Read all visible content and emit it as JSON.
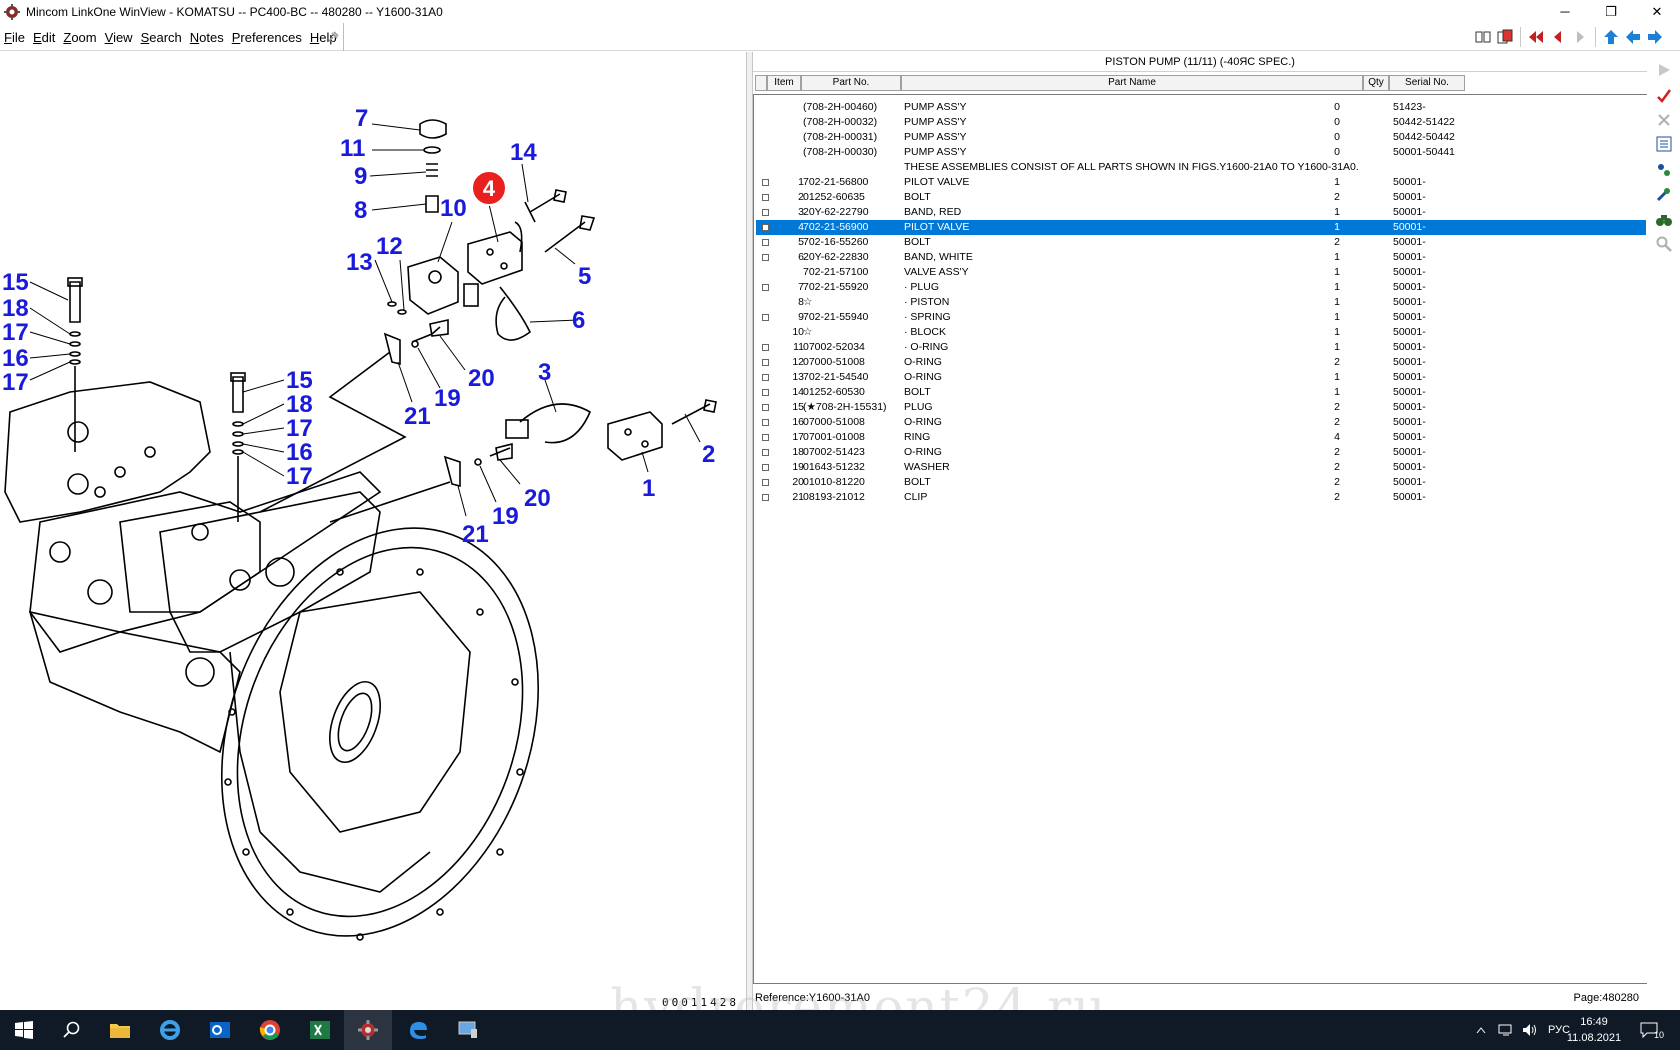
{
  "window": {
    "title": "Mincom LinkOne WinView - KOMATSU -- PC400-BC -- 480280 -- Y1600-31A0",
    "minimize": "─",
    "restore": "❐",
    "close": "✕"
  },
  "menu": {
    "items": [
      {
        "label": "File"
      },
      {
        "label": "Edit"
      },
      {
        "label": "Zoom"
      },
      {
        "label": "View"
      },
      {
        "label": "Search"
      },
      {
        "label": "Notes"
      },
      {
        "label": "Preferences"
      },
      {
        "label": "Help"
      }
    ]
  },
  "drawing": {
    "number": "00011428",
    "callouts": [
      "7",
      "11",
      "9",
      "8",
      "10",
      "14",
      "4",
      "13",
      "12",
      "5",
      "6",
      "15",
      "18",
      "17",
      "16",
      "17",
      "15",
      "18",
      "17",
      "16",
      "17",
      "20",
      "19",
      "21",
      "3",
      "2",
      "1",
      "20",
      "19",
      "21"
    ]
  },
  "parts_list": {
    "title": "PISTON PUMP (11/11) (-40ЯС SPEC.)",
    "columns": {
      "item": "Item",
      "part_no": "Part No.",
      "part_name": "Part Name",
      "qty": "Qty",
      "serial": "Serial No."
    },
    "rows": [
      {
        "cb": false,
        "item": "",
        "part_no": "(708-2H-00460)",
        "name": "PUMP ASS'Y",
        "qty": "0",
        "serial": "51423-"
      },
      {
        "cb": false,
        "item": "",
        "part_no": "(708-2H-00032)",
        "name": "PUMP ASS'Y",
        "qty": "0",
        "serial": "50442-51422"
      },
      {
        "cb": false,
        "item": "",
        "part_no": "(708-2H-00031)",
        "name": "PUMP ASS'Y",
        "qty": "0",
        "serial": "50442-50442"
      },
      {
        "cb": false,
        "item": "",
        "part_no": "(708-2H-00030)",
        "name": "PUMP ASS'Y",
        "qty": "0",
        "serial": "50001-50441"
      },
      {
        "cb": false,
        "item": "",
        "part_no": "",
        "name": "THESE ASSEMBLIES CONSIST OF ALL PARTS SHOWN IN FIGS.Y1600-21A0 TO Y1600-31A0.",
        "qty": "",
        "serial": ""
      },
      {
        "cb": true,
        "item": "1",
        "part_no": "702-21-56800",
        "name": "PILOT VALVE",
        "qty": "1",
        "serial": "50001-"
      },
      {
        "cb": true,
        "item": "2",
        "part_no": "01252-60635",
        "name": "BOLT",
        "qty": "2",
        "serial": "50001-"
      },
      {
        "cb": true,
        "item": "3",
        "part_no": "20Y-62-22790",
        "name": "BAND, RED",
        "qty": "1",
        "serial": "50001-"
      },
      {
        "cb": true,
        "item": "4",
        "part_no": "702-21-56900",
        "name": "PILOT VALVE",
        "qty": "1",
        "serial": "50001-",
        "selected": true
      },
      {
        "cb": true,
        "item": "5",
        "part_no": "702-16-55260",
        "name": "BOLT",
        "qty": "2",
        "serial": "50001-"
      },
      {
        "cb": true,
        "item": "6",
        "part_no": "20Y-62-22830",
        "name": "BAND, WHITE",
        "qty": "1",
        "serial": "50001-"
      },
      {
        "cb": false,
        "item": "",
        "part_no": "702-21-57100",
        "name": "VALVE ASS'Y",
        "qty": "1",
        "serial": "50001-"
      },
      {
        "cb": true,
        "item": "7",
        "part_no": "702-21-55920",
        "name": "· PLUG",
        "qty": "1",
        "serial": "50001-"
      },
      {
        "cb": false,
        "item": "8",
        "part_no": "☆",
        "name": "· PISTON",
        "qty": "1",
        "serial": "50001-"
      },
      {
        "cb": true,
        "item": "9",
        "part_no": "702-21-55940",
        "name": "· SPRING",
        "qty": "1",
        "serial": "50001-"
      },
      {
        "cb": false,
        "item": "10",
        "part_no": "☆",
        "name": "· BLOCK",
        "qty": "1",
        "serial": "50001-"
      },
      {
        "cb": true,
        "item": "11",
        "part_no": "07002-52034",
        "name": "· O-RING",
        "qty": "1",
        "serial": "50001-"
      },
      {
        "cb": true,
        "item": "12",
        "part_no": "07000-51008",
        "name": "O-RING",
        "qty": "2",
        "serial": "50001-"
      },
      {
        "cb": true,
        "item": "13",
        "part_no": "702-21-54540",
        "name": "O-RING",
        "qty": "1",
        "serial": "50001-"
      },
      {
        "cb": true,
        "item": "14",
        "part_no": "01252-60530",
        "name": "BOLT",
        "qty": "1",
        "serial": "50001-"
      },
      {
        "cb": true,
        "item": "15",
        "part_no": "(★708-2H-15531)",
        "name": "PLUG",
        "qty": "2",
        "serial": "50001-"
      },
      {
        "cb": true,
        "item": "16",
        "part_no": "07000-51008",
        "name": "O-RING",
        "qty": "2",
        "serial": "50001-"
      },
      {
        "cb": true,
        "item": "17",
        "part_no": "07001-01008",
        "name": "RING",
        "qty": "4",
        "serial": "50001-"
      },
      {
        "cb": true,
        "item": "18",
        "part_no": "07002-51423",
        "name": "O-RING",
        "qty": "2",
        "serial": "50001-"
      },
      {
        "cb": true,
        "item": "19",
        "part_no": "01643-51232",
        "name": "WASHER",
        "qty": "2",
        "serial": "50001-"
      },
      {
        "cb": true,
        "item": "20",
        "part_no": "01010-81220",
        "name": "BOLT",
        "qty": "2",
        "serial": "50001-"
      },
      {
        "cb": true,
        "item": "21",
        "part_no": "08193-21012",
        "name": "CLIP",
        "qty": "2",
        "serial": "50001-"
      }
    ],
    "reference": "Reference:Y1600-31A0",
    "page": "Page:480280"
  },
  "watermark": "hydroremont24.ru",
  "taskbar": {
    "language": "РУС",
    "time": "16:49",
    "date": "11.08.2021",
    "notifications": "10"
  },
  "colors": {
    "callout": "#1a1adb",
    "highlight": "#0078d7",
    "marker": "#e8201e",
    "taskbar": "#101a26"
  }
}
